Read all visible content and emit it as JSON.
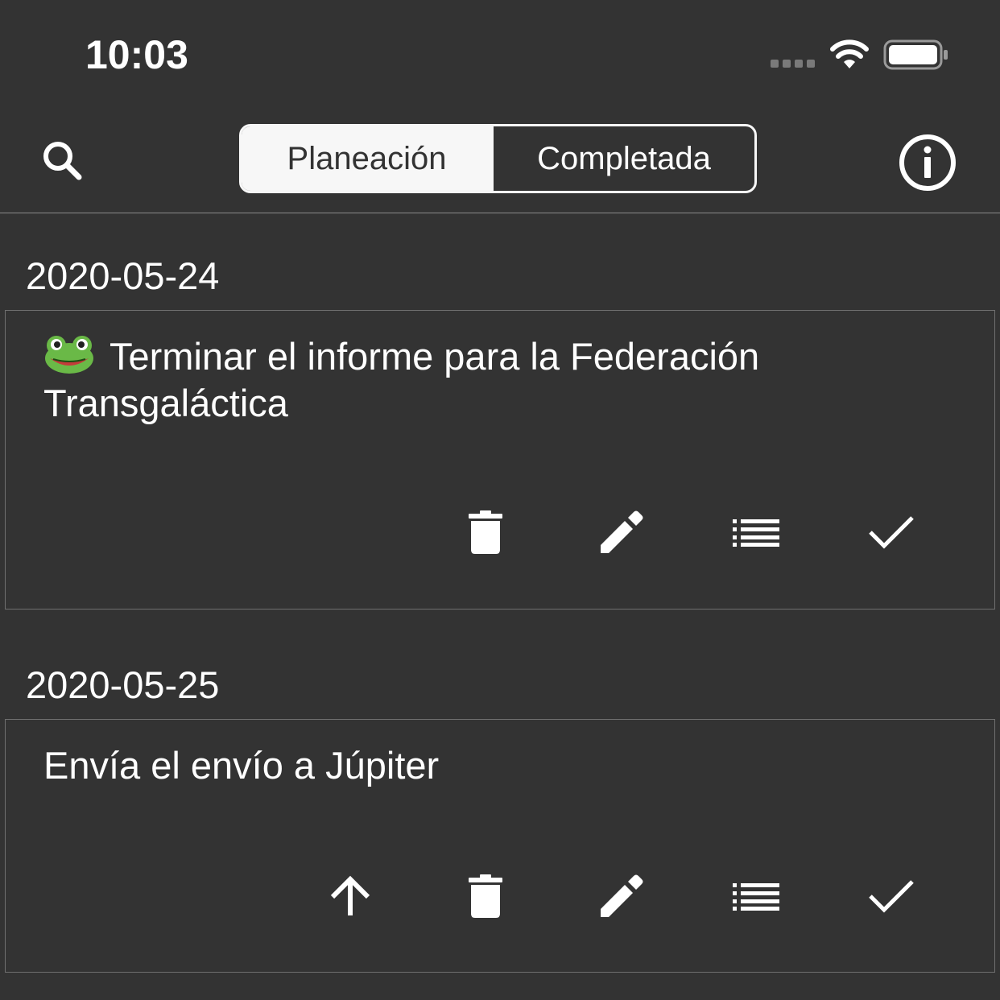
{
  "status_bar": {
    "time": "10:03"
  },
  "nav": {
    "segments": [
      "Planeación",
      "Completada"
    ],
    "selected": "Planeación"
  },
  "sections": [
    {
      "date": "2020-05-24",
      "task": "Terminar el informe para la Federación Transgaláctica",
      "task_icon": "frog-emoji",
      "actions": [
        "delete-icon",
        "edit-icon",
        "list-icon",
        "check-icon"
      ]
    },
    {
      "date": "2020-05-25",
      "task": "Envía el envío a Júpiter",
      "actions": [
        "arrow-up-icon",
        "delete-icon",
        "edit-icon",
        "list-icon",
        "check-icon"
      ]
    }
  ],
  "colors": {
    "background": "#333333",
    "foreground": "#ffffff",
    "segment_active_bg": "#f7f7f7",
    "segment_active_text": "#333333",
    "frog_green": "#6ab947"
  }
}
